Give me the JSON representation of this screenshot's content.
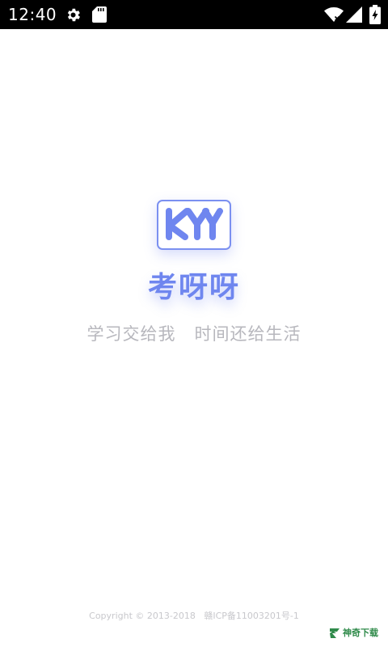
{
  "status_bar": {
    "time": "12:40",
    "icons": [
      "gear-icon",
      "sd-card-icon",
      "wifi-icon",
      "signal-icon",
      "battery-charging-icon"
    ]
  },
  "splash": {
    "logo_text": "KYY",
    "app_name": "考呀呀",
    "slogan": "学习交给我   时间还给生活",
    "copyright": "Copyright © 2013-2018   赣ICP备11003201号-1",
    "accent_color": "#6f86ef"
  },
  "watermark": {
    "text": "神奇下载"
  }
}
